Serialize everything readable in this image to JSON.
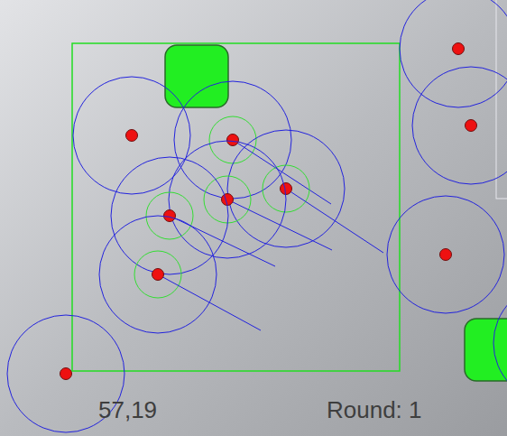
{
  "status": {
    "position": "57,19",
    "round": "Round: 1"
  },
  "agents": [
    {
      "kind": "idle"
    },
    {
      "kind": "moving"
    },
    {
      "kind": "moving"
    },
    {
      "kind": "moving"
    },
    {
      "kind": "moving"
    },
    {
      "kind": "moving"
    },
    {
      "kind": "idle"
    },
    {
      "kind": "idle"
    },
    {
      "kind": "idle"
    },
    {
      "kind": "idle"
    },
    {
      "kind": "idle"
    }
  ]
}
